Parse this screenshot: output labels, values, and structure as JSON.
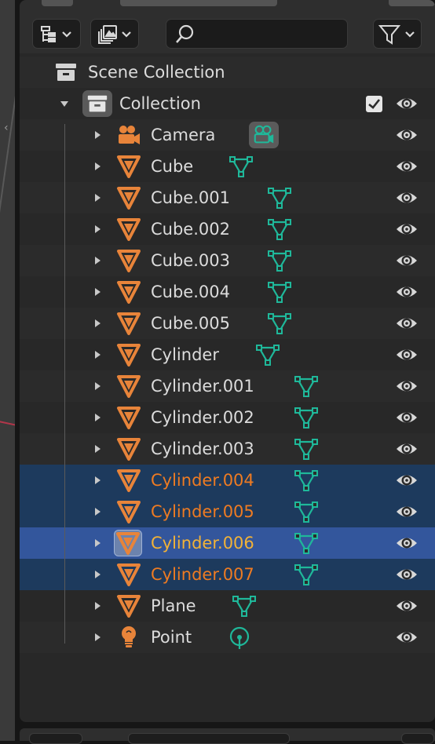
{
  "header": {
    "display_mode_icon": "outliner-display-mode-icon",
    "view_layer_icon": "view-layer-icon",
    "search": {
      "value": "",
      "placeholder": ""
    },
    "filter_icon": "filter-icon"
  },
  "tree": {
    "scene_collection": {
      "label": "Scene Collection",
      "icon": "scene-collection-icon"
    },
    "collection": {
      "label": "Collection",
      "icon": "collection-icon",
      "checked": true,
      "expanded": true
    },
    "items": [
      {
        "label": "Camera",
        "type": "camera",
        "data_icon": "camera-data-icon",
        "selected": false,
        "active": false
      },
      {
        "label": "Cube",
        "type": "mesh",
        "data_icon": "mesh-data-icon",
        "selected": false,
        "active": false
      },
      {
        "label": "Cube.001",
        "type": "mesh",
        "data_icon": "mesh-data-icon",
        "selected": false,
        "active": false
      },
      {
        "label": "Cube.002",
        "type": "mesh",
        "data_icon": "mesh-data-icon",
        "selected": false,
        "active": false
      },
      {
        "label": "Cube.003",
        "type": "mesh",
        "data_icon": "mesh-data-icon",
        "selected": false,
        "active": false
      },
      {
        "label": "Cube.004",
        "type": "mesh",
        "data_icon": "mesh-data-icon",
        "selected": false,
        "active": false
      },
      {
        "label": "Cube.005",
        "type": "mesh",
        "data_icon": "mesh-data-icon",
        "selected": false,
        "active": false
      },
      {
        "label": "Cylinder",
        "type": "mesh",
        "data_icon": "mesh-data-icon",
        "selected": false,
        "active": false
      },
      {
        "label": "Cylinder.001",
        "type": "mesh",
        "data_icon": "mesh-data-icon",
        "selected": false,
        "active": false
      },
      {
        "label": "Cylinder.002",
        "type": "mesh",
        "data_icon": "mesh-data-icon",
        "selected": false,
        "active": false
      },
      {
        "label": "Cylinder.003",
        "type": "mesh",
        "data_icon": "mesh-data-icon",
        "selected": false,
        "active": false
      },
      {
        "label": "Cylinder.004",
        "type": "mesh",
        "data_icon": "mesh-data-icon",
        "selected": true,
        "active": false
      },
      {
        "label": "Cylinder.005",
        "type": "mesh",
        "data_icon": "mesh-data-icon",
        "selected": true,
        "active": false
      },
      {
        "label": "Cylinder.006",
        "type": "mesh",
        "data_icon": "mesh-data-icon",
        "selected": true,
        "active": true
      },
      {
        "label": "Cylinder.007",
        "type": "mesh",
        "data_icon": "mesh-data-icon",
        "selected": true,
        "active": false
      },
      {
        "label": "Plane",
        "type": "mesh",
        "data_icon": "mesh-data-icon",
        "selected": false,
        "active": false
      },
      {
        "label": "Point",
        "type": "light",
        "data_icon": "light-data-icon",
        "selected": false,
        "active": false
      }
    ]
  },
  "colors": {
    "object_orange": "#e8843a",
    "data_green": "#1fb89a",
    "selected_text": "#ee7b22",
    "active_text": "#f2b237",
    "selected_row": "#1d3a5d",
    "active_row": "#33569c"
  }
}
